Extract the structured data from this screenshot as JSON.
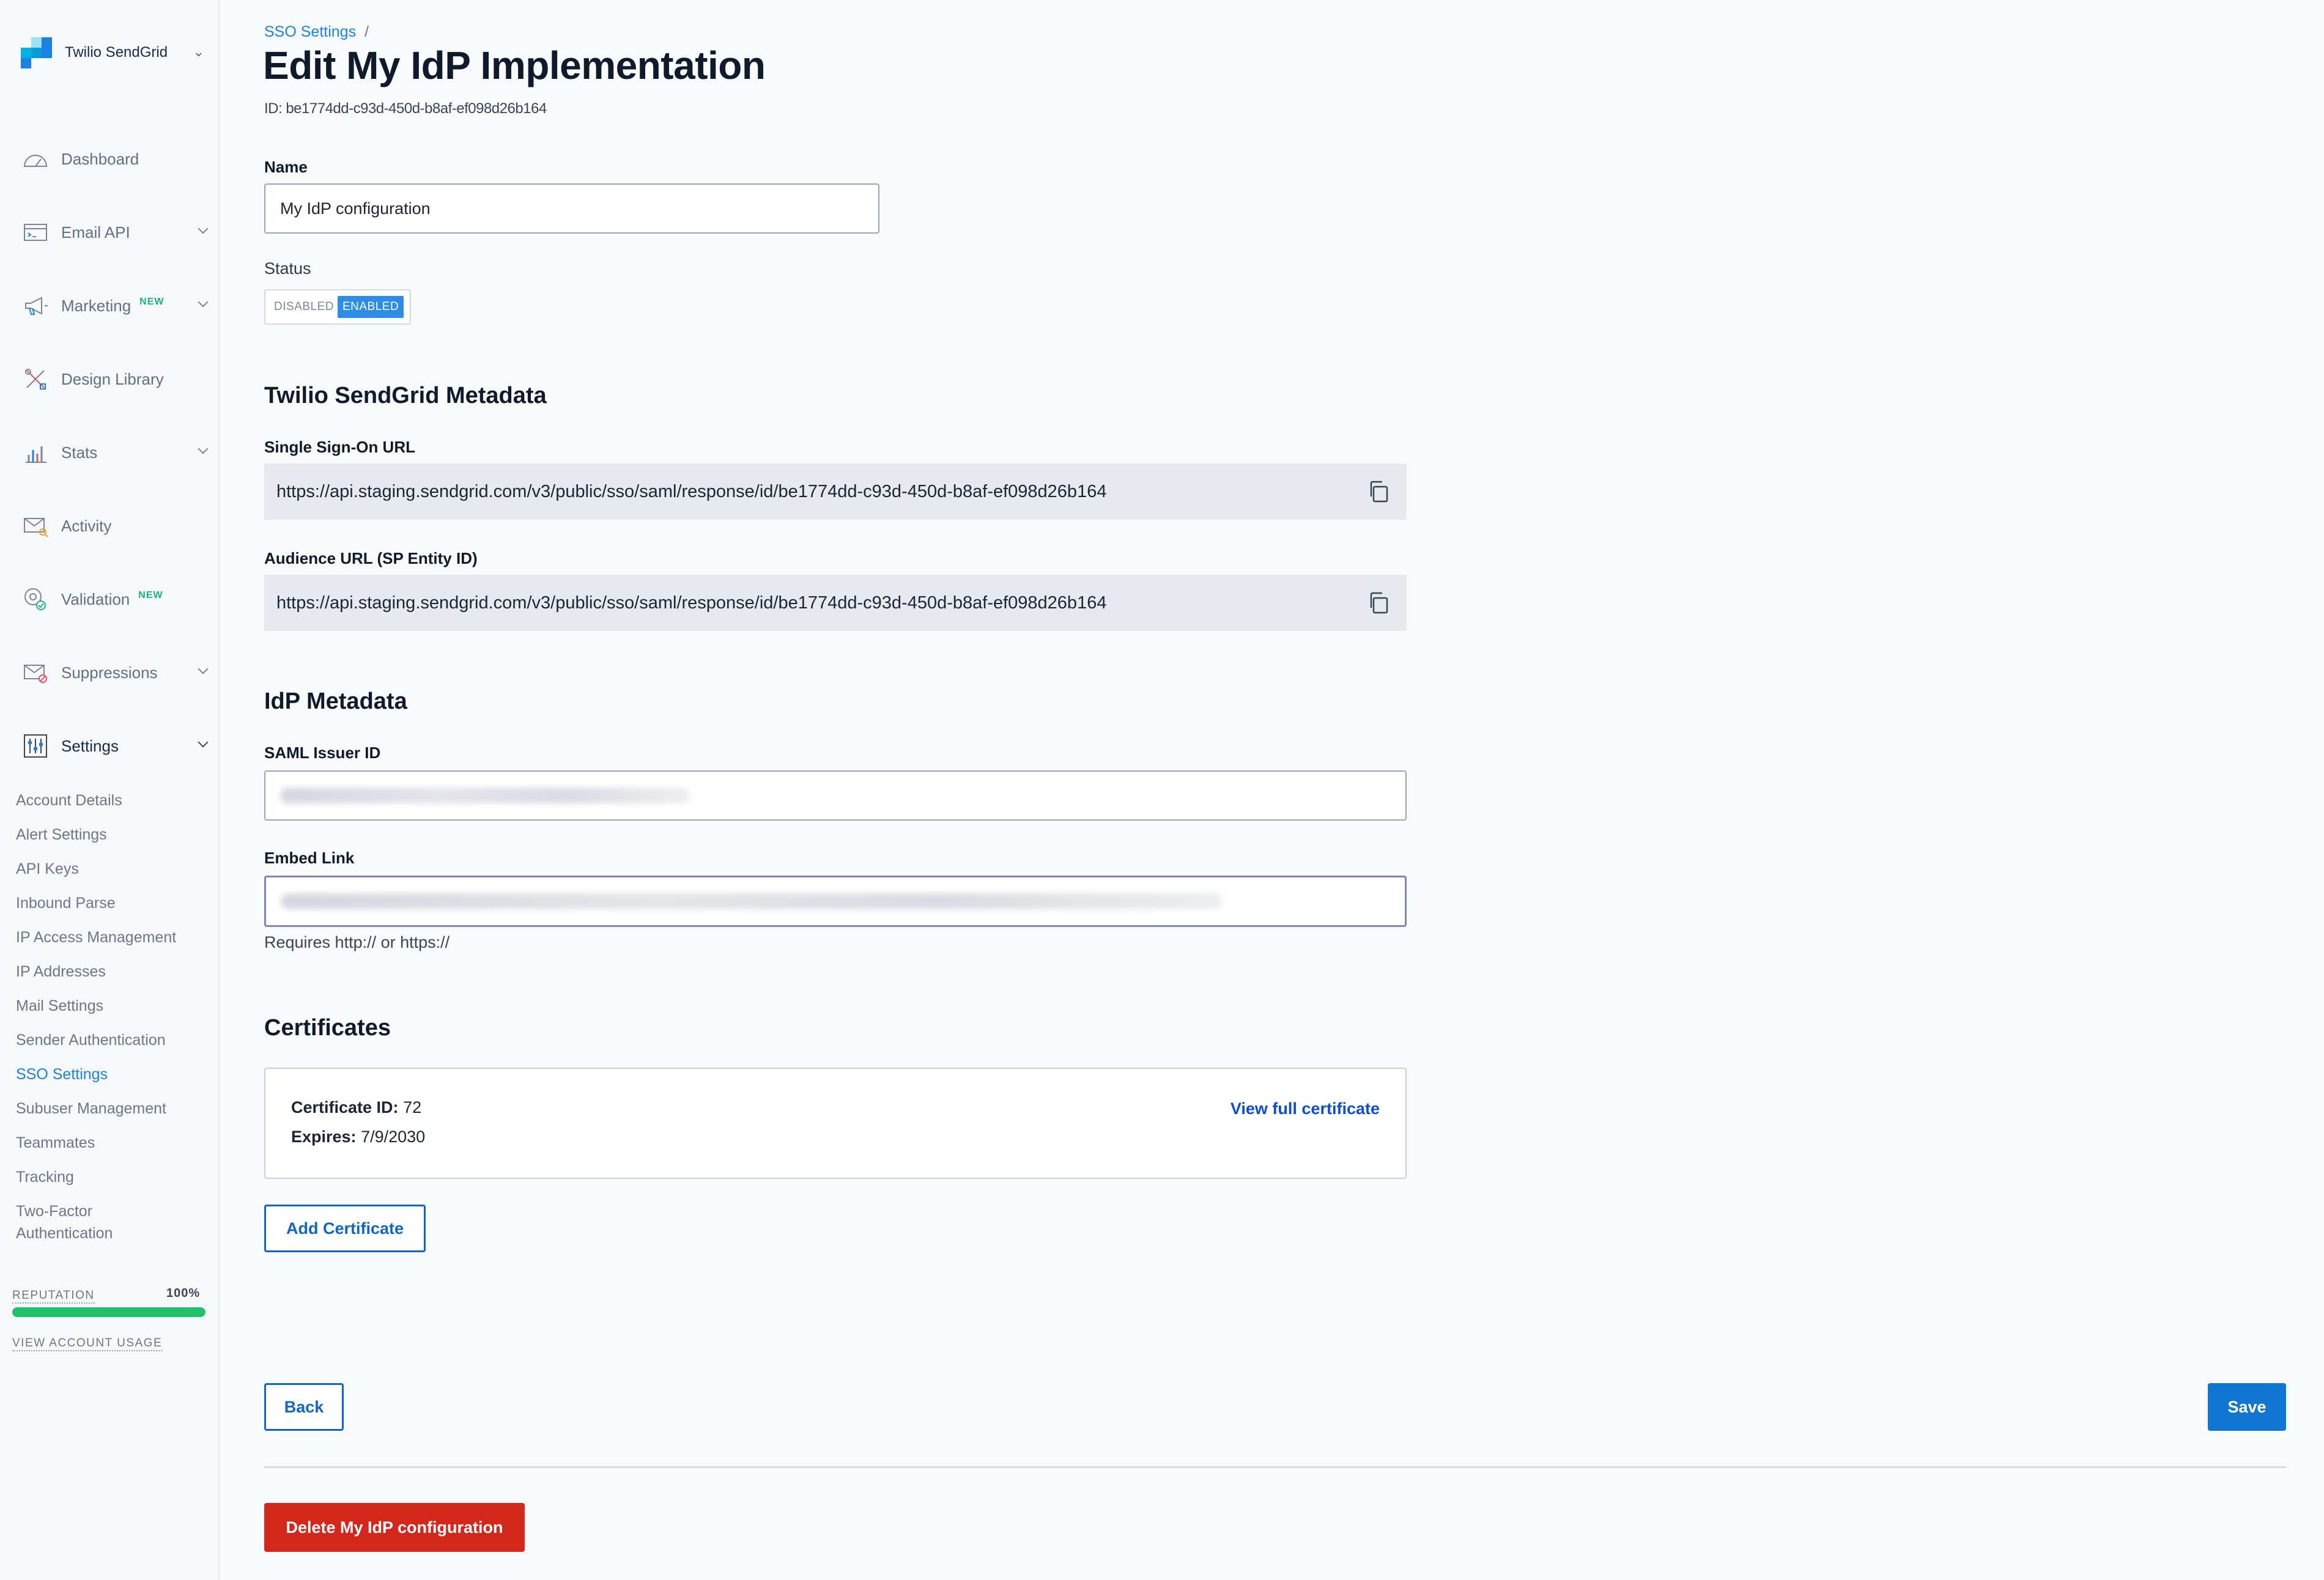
{
  "brand": {
    "name": "Twilio SendGrid"
  },
  "sidebar": {
    "nav": [
      {
        "label": "Dashboard",
        "icon": "dashboard-gauge-icon",
        "has_chevron": false,
        "badge": ""
      },
      {
        "label": "Email API",
        "icon": "email-api-icon",
        "has_chevron": true,
        "badge": ""
      },
      {
        "label": "Marketing",
        "icon": "megaphone-icon",
        "has_chevron": true,
        "badge": "NEW"
      },
      {
        "label": "Design Library",
        "icon": "design-tools-icon",
        "has_chevron": false,
        "badge": ""
      },
      {
        "label": "Stats",
        "icon": "bar-chart-icon",
        "has_chevron": true,
        "badge": ""
      },
      {
        "label": "Activity",
        "icon": "activity-envelope-icon",
        "has_chevron": false,
        "badge": ""
      },
      {
        "label": "Validation",
        "icon": "at-sign-check-icon",
        "has_chevron": false,
        "badge": "NEW"
      },
      {
        "label": "Suppressions",
        "icon": "suppressed-envelope-icon",
        "has_chevron": true,
        "badge": ""
      },
      {
        "label": "Settings",
        "icon": "settings-sliders-icon",
        "has_chevron": true,
        "badge": ""
      }
    ],
    "settings_items": [
      "Account Details",
      "Alert Settings",
      "API Keys",
      "Inbound Parse",
      "IP Access Management",
      "IP Addresses",
      "Mail Settings",
      "Sender Authentication",
      "SSO Settings",
      "Subuser Management",
      "Teammates",
      "Tracking",
      "Two-Factor",
      "Authentication"
    ],
    "active_settings_item": "SSO Settings",
    "reputation": {
      "label": "REPUTATION",
      "value_text": "100%",
      "percent": 100
    },
    "usage_link": "VIEW ACCOUNT USAGE"
  },
  "breadcrumb": {
    "parent": "SSO Settings",
    "separator": "/"
  },
  "page": {
    "title": "Edit My IdP Implementation",
    "id_text": "ID: be1774dd-c93d-450d-b8af-ef098d26b164"
  },
  "form": {
    "name_label": "Name",
    "name_value": "My IdP configuration",
    "status_label": "Status",
    "status_off": "DISABLED",
    "status_on": "ENABLED"
  },
  "sg_metadata": {
    "title": "Twilio SendGrid Metadata",
    "sso_url_label": "Single Sign-On URL",
    "sso_url": "https://api.staging.sendgrid.com/v3/public/sso/saml/response/id/be1774dd-c93d-450d-b8af-ef098d26b164",
    "audience_label": "Audience URL (SP Entity ID)",
    "audience_url": "https://api.staging.sendgrid.com/v3/public/sso/saml/response/id/be1774dd-c93d-450d-b8af-ef098d26b164"
  },
  "idp_metadata": {
    "title": "IdP Metadata",
    "issuer_label": "SAML Issuer ID",
    "embed_label": "Embed Link",
    "embed_helper": "Requires http:// or https://"
  },
  "certificates": {
    "title": "Certificates",
    "id_label": "Certificate ID:",
    "id_value": "72",
    "expires_label": "Expires:",
    "expires_value": "7/9/2030",
    "view_link": "View full certificate",
    "add_button": "Add Certificate"
  },
  "actions": {
    "back": "Back",
    "save": "Save",
    "delete": "Delete My IdP configuration"
  },
  "colors": {
    "accent": "#1a82e2",
    "primary_button": "#1175d2",
    "danger": "#d3271c",
    "reputation_bar": "#1ec26a",
    "new_badge": "#1ab280"
  }
}
